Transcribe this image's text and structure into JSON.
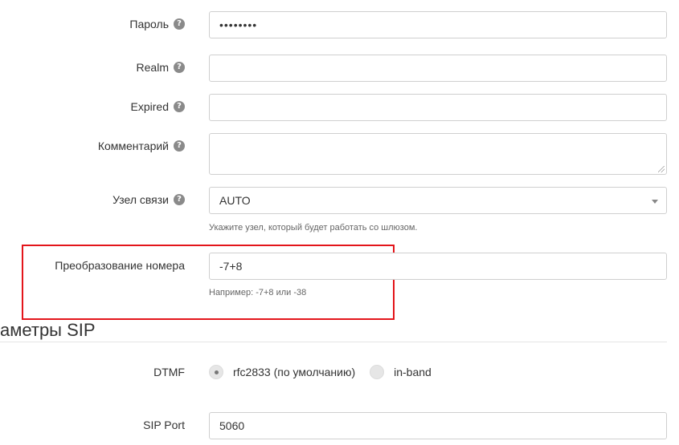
{
  "fields": {
    "password": {
      "label": "Пароль",
      "value": "••••••••"
    },
    "realm": {
      "label": "Realm",
      "value": ""
    },
    "expired": {
      "label": "Expired",
      "value": ""
    },
    "comment": {
      "label": "Комментарий",
      "value": ""
    },
    "node": {
      "label": "Узел связи",
      "value": "AUTO",
      "hint": "Укажите узел, который будет работать со шлюзом."
    },
    "number_transform": {
      "label": "Преобразование номера",
      "value": "-7+8",
      "hint": "Например: -7+8 или -38"
    }
  },
  "sip_section": {
    "title": "аметры SIP",
    "dtmf": {
      "label": "DTMF",
      "options": [
        {
          "label": "rfc2833 (по умолчанию)",
          "checked": true
        },
        {
          "label": "in-band",
          "checked": false
        }
      ]
    },
    "sip_port": {
      "label": "SIP Port",
      "value": "5060"
    }
  },
  "icons": {
    "help": "?"
  },
  "colors": {
    "highlight": "#e3151b"
  }
}
